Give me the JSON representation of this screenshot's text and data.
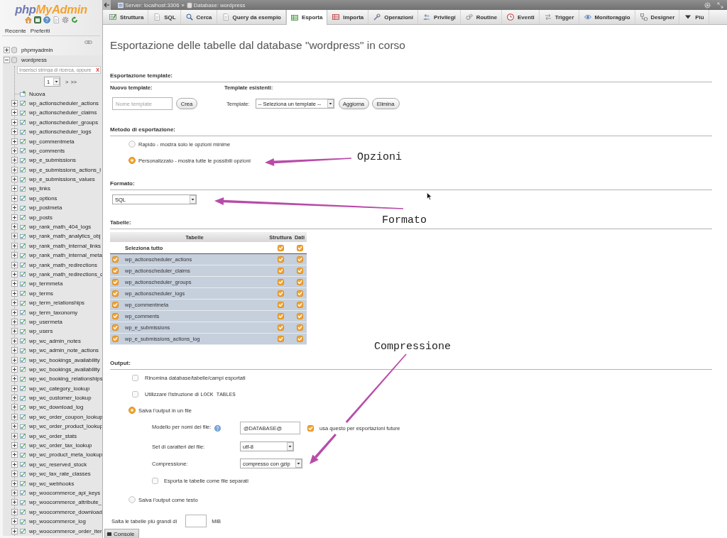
{
  "navigation": {
    "logo_parts": [
      "php",
      "MyAdmin"
    ],
    "tabs": [
      {
        "label": "Recente"
      },
      {
        "label": "Preferiti"
      }
    ],
    "databases": [
      {
        "name": "phpmyadmin",
        "expanded": false
      },
      {
        "name": "wordpress",
        "expanded": true,
        "filter": {
          "placeholder": "Inserisci stringa di ricerca, oppure",
          "clear": "X"
        },
        "pager": {
          "page": "1",
          "links": [
            ">",
            ">>"
          ]
        },
        "new_label": "Nuova",
        "tables": [
          "wp_actionscheduler_actions",
          "wp_actionscheduler_claims",
          "wp_actionscheduler_groups",
          "wp_actionscheduler_logs",
          "wp_commentmeta",
          "wp_comments",
          "wp_e_submissions",
          "wp_e_submissions_actions_l",
          "wp_e_submissions_values",
          "wp_links",
          "wp_options",
          "wp_postmeta",
          "wp_posts",
          "wp_rank_math_404_logs",
          "wp_rank_math_analytics_obj",
          "wp_rank_math_internal_links",
          "wp_rank_math_internal_meta",
          "wp_rank_math_redirections",
          "wp_rank_math_redirections_c",
          "wp_termmeta",
          "wp_terms",
          "wp_term_relationships",
          "wp_term_taxonomy",
          "wp_usermeta",
          "wp_users",
          "wp_wc_admin_notes",
          "wp_wc_admin_note_actions",
          "wp_wc_bookings_availability",
          "wp_wc_bookings_availability",
          "wp_wc_booking_relationships",
          "wp_wc_category_lookup",
          "wp_wc_customer_lookup",
          "wp_wc_download_log",
          "wp_wc_order_coupon_lookup",
          "wp_wc_order_product_lookup",
          "wp_wc_order_stats",
          "wp_wc_order_tax_lookup",
          "wp_wc_product_meta_lookup",
          "wp_wc_reserved_stock",
          "wp_wc_tax_rate_classes",
          "wp_wc_webhooks",
          "wp_woocommerce_api_keys",
          "wp_woocommerce_attribute_",
          "wp_woocommerce_download",
          "wp_woocommerce_log",
          "wp_woocommerce_order_iter"
        ]
      }
    ]
  },
  "top_bar": {
    "breadcrumb": [
      {
        "text": "Server: localhost:3306"
      },
      {
        "text": "Database: wordpress"
      }
    ],
    "separator": "»"
  },
  "tabs": [
    {
      "label": "Struttura",
      "selected": false
    },
    {
      "label": "SQL",
      "selected": false
    },
    {
      "label": "Cerca",
      "selected": false
    },
    {
      "label": "Query da esempio",
      "selected": false
    },
    {
      "label": "Esporta",
      "selected": true
    },
    {
      "label": "Importa",
      "selected": false
    },
    {
      "label": "Operazioni",
      "selected": false
    },
    {
      "label": "Privilegi",
      "selected": false
    },
    {
      "label": "Routine",
      "selected": false
    },
    {
      "label": "Eventi",
      "selected": false
    },
    {
      "label": "Trigger",
      "selected": false
    },
    {
      "label": "Monitoraggio",
      "selected": false
    },
    {
      "label": "Designer",
      "selected": false
    },
    {
      "label": "Più",
      "selected": false
    }
  ],
  "page_title": "Esportazione delle tabelle dal database \"wordpress\" in corso",
  "export_template": {
    "heading": "Esportazione template:",
    "new_template": {
      "heading": "Nuovo template:",
      "placeholder": "Nome template",
      "button": "Crea"
    },
    "existing": {
      "heading": "Template esistenti:",
      "label": "Template:",
      "value": "-- Seleziona un template --",
      "buttons": [
        "Aggiorna",
        "Elimina"
      ]
    }
  },
  "export_method": {
    "heading": "Metodo di esportazione:",
    "options": [
      {
        "label": "Rapido - mostra solo le opzioni minime",
        "selected": false
      },
      {
        "label": "Personalizzato - mostra tutte le possibili opzioni",
        "selected": true
      }
    ]
  },
  "format": {
    "heading": "Formato:",
    "value": "SQL"
  },
  "tables": {
    "heading": "Tabelle:",
    "columns": [
      "Tabelle",
      "Struttura",
      "Dati"
    ],
    "select_all": {
      "label": "Seleziona tutto",
      "structure": true,
      "data": true
    },
    "rows": [
      {
        "name": "wp_actionscheduler_actions",
        "selected": true,
        "structure": true,
        "data": true
      },
      {
        "name": "wp_actionscheduler_claims",
        "selected": true,
        "structure": true,
        "data": true
      },
      {
        "name": "wp_actionscheduler_groups",
        "selected": true,
        "structure": true,
        "data": true
      },
      {
        "name": "wp_actionscheduler_logs",
        "selected": true,
        "structure": true,
        "data": true
      },
      {
        "name": "wp_commentmeta",
        "selected": true,
        "structure": true,
        "data": true
      },
      {
        "name": "wp_comments",
        "selected": true,
        "structure": true,
        "data": true
      },
      {
        "name": "wp_e_submissions",
        "selected": true,
        "structure": true,
        "data": true
      },
      {
        "name": "wp_e_submissions_actions_log",
        "selected": true,
        "structure": true,
        "data": true
      }
    ]
  },
  "output": {
    "heading": "Output:",
    "options": [
      {
        "kind": "checkbox",
        "label": "Rinomina database/tabelle/campi esportati",
        "checked": false
      },
      {
        "kind": "checkbox",
        "label": "Utilizzare l'istruzione di",
        "code": "LOCK TABLES",
        "checked": false
      },
      {
        "kind": "radio",
        "label": "Salva l'output in un file",
        "selected": true,
        "file_options": {
          "filename_template": {
            "label": "Modello per nomi dei file:",
            "value": "@DATABASE@",
            "remember": {
              "label": "usa questo per esportazioni future",
              "checked": true
            }
          },
          "charset": {
            "label": "Set di caratteri del file:",
            "value": "utf-8"
          },
          "compression": {
            "label": "Compressione:",
            "value": "compresso con gzip"
          },
          "separate_files": {
            "label": "Esporta le tabelle come file separati",
            "checked": false
          }
        }
      },
      {
        "kind": "radio",
        "label": "Salva l'output come testo",
        "selected": false
      }
    ],
    "skip_tables": {
      "label": "Salta le tabelle più grandi di",
      "unit": "MiB"
    }
  },
  "console": {
    "label": "Console"
  },
  "annotations": [
    {
      "text": "Opzioni"
    },
    {
      "text": "Formato"
    },
    {
      "text": "Compressione"
    }
  ]
}
